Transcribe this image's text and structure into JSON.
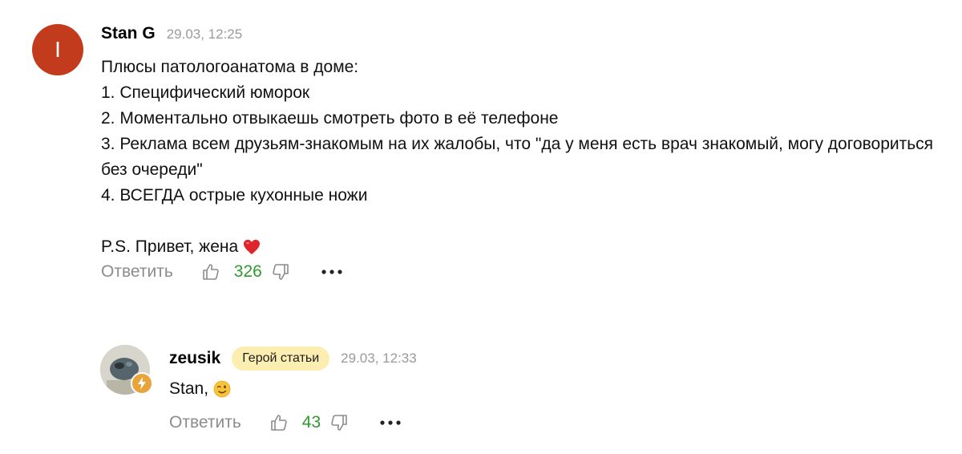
{
  "comments": [
    {
      "avatar_letter": "I",
      "author": "Stan G",
      "date": "29.03, 12:25",
      "lines": [
        "Плюсы патологоанатома в доме:",
        "1. Специфический юморок",
        "2. Моментально отвыкаешь смотреть фото в её телефоне",
        "3. Реклама всем друзьям-знакомым на их жалобы, что \"да у меня есть врач знакомый, могу договориться без очереди\"",
        "4. ВСЕГДА острые кухонные ножи",
        "",
        "P.S. Привет, жена"
      ],
      "reply_label": "Ответить",
      "likes": "326"
    },
    {
      "author": "zeusik",
      "badge": "Герой статьи",
      "date": "29.03, 12:33",
      "text": "Stan,",
      "reply_label": "Ответить",
      "likes": "43"
    }
  ],
  "colors": {
    "avatar_bg": "#c23b1c",
    "likes": "#2e9a2e",
    "muted": "#8c8c8c",
    "badge_bg": "#fbeeb0",
    "author_badge": "#e8a33a"
  },
  "icons": [
    "thumbs-up-icon",
    "thumbs-down-icon",
    "more-icon",
    "heart-emoji",
    "wink-emoji",
    "author-lightning-icon"
  ]
}
